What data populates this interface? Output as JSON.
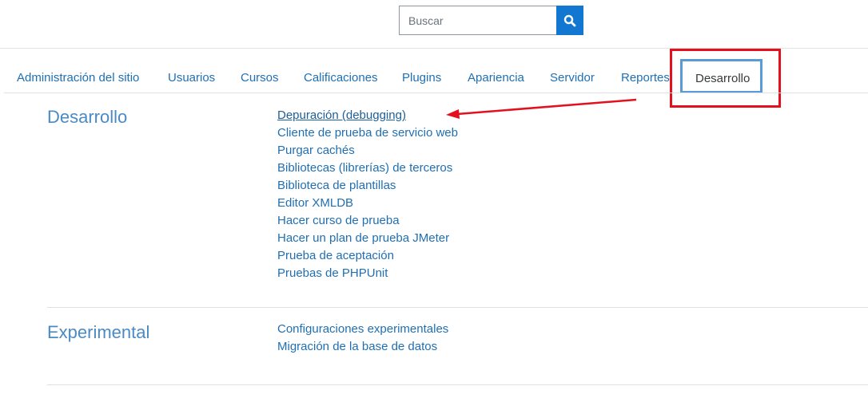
{
  "search": {
    "placeholder": "Buscar",
    "button_icon": "search-icon"
  },
  "tabs": [
    {
      "label": "Administración del sitio"
    },
    {
      "label": "Usuarios"
    },
    {
      "label": "Cursos"
    },
    {
      "label": "Calificaciones"
    },
    {
      "label": "Plugins"
    },
    {
      "label": "Apariencia"
    },
    {
      "label": "Servidor"
    },
    {
      "label": "Reportes"
    },
    {
      "label": "Desarrollo",
      "active": true
    }
  ],
  "sections": [
    {
      "title": "Desarrollo",
      "links": [
        "Depuración (debugging)",
        "Cliente de prueba de servicio web",
        "Purgar cachés",
        "Bibliotecas (librerías) de terceros",
        "Biblioteca de plantillas",
        "Editor XMLDB",
        "Hacer curso de prueba",
        "Hacer un plan de prueba JMeter",
        "Prueba de aceptación",
        "Pruebas de PHPUnit"
      ]
    },
    {
      "title": "Experimental",
      "links": [
        "Configuraciones experimentales",
        "Migración de la base de datos"
      ]
    }
  ],
  "colors": {
    "link": "#1f6fb3",
    "highlight_red": "#e4101e",
    "active_tab_border": "#5b9bd5",
    "search_button": "#1177d1"
  }
}
